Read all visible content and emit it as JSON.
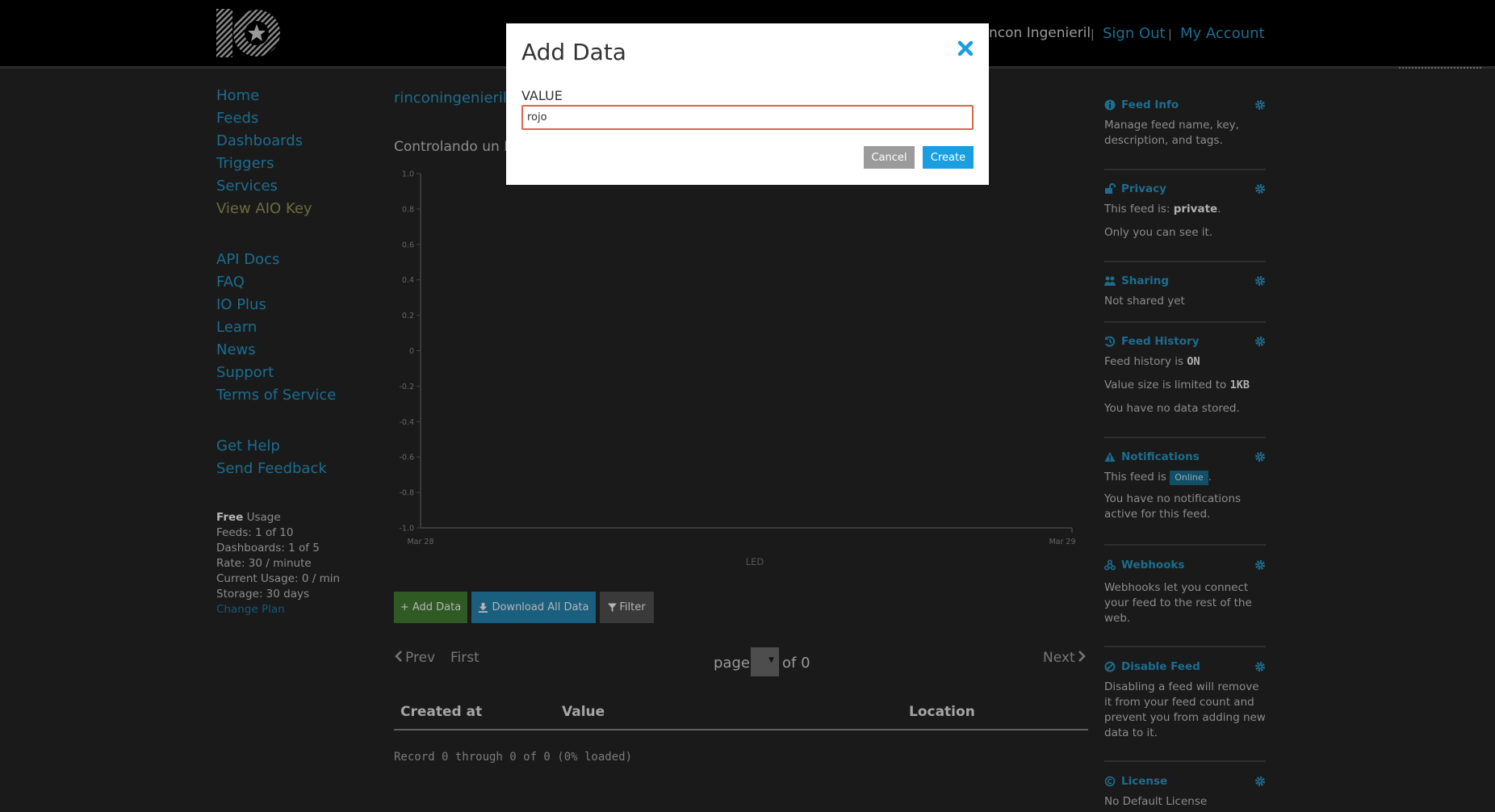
{
  "header": {
    "account_name": "ncon Ingenieril",
    "separator": "|",
    "sign_out": "Sign Out",
    "my_account": "My Account"
  },
  "left_nav": {
    "primary": [
      "Home",
      "Feeds",
      "Dashboards",
      "Triggers",
      "Services",
      "View AIO Key"
    ],
    "secondary": [
      "API Docs",
      "FAQ",
      "IO Plus",
      "Learn",
      "News",
      "Support",
      "Terms of Service"
    ],
    "help": [
      "Get Help",
      "Send Feedback"
    ],
    "usage": {
      "plan": "Free",
      "plan_suffix": " Usage",
      "feeds": "Feeds: 1 of 10",
      "dashboards": "Dashboards: 1 of 5",
      "rate": "Rate: 30 / minute",
      "current_usage": "Current Usage: 0 / min",
      "storage": "Storage: 30 days",
      "change_plan": "Change Plan"
    }
  },
  "main": {
    "breadcrumb": "rinconingenieril",
    "description": "Controlando un L",
    "buttons": {
      "add_data": "+ Add Data",
      "download_all": "Download All Data",
      "filter": "Filter"
    },
    "pagination": {
      "prev": "Prev",
      "first": "First",
      "page_label": "page",
      "of": "of 0",
      "next": "Next"
    },
    "table": {
      "columns": [
        "Created at",
        "Value",
        "Location"
      ],
      "status": "Record 0 through 0 of 0 (0% loaded)"
    }
  },
  "chart_data": {
    "type": "line",
    "title": "",
    "xlabel": "LED",
    "ylabel": "",
    "x_ticks": [
      "Mar 28",
      "Mar 29"
    ],
    "y_ticks": [
      "1.0",
      "0.8",
      "0.6",
      "0.4",
      "0.2",
      "0",
      "-0.2",
      "-0.4",
      "-0.6",
      "-0.8",
      "-1.0"
    ],
    "ylim": [
      -1.0,
      1.0
    ],
    "series": [],
    "grid": false
  },
  "sidebar": {
    "feed_info": {
      "title": "Feed Info",
      "text": "Manage feed name, key, description, and tags."
    },
    "privacy": {
      "title": "Privacy",
      "text_prefix": "This feed is: ",
      "status": "private",
      "text_suffix": ".",
      "text2": "Only you can see it."
    },
    "sharing": {
      "title": "Sharing",
      "text": "Not shared yet"
    },
    "feed_history": {
      "title": "Feed History",
      "line1_prefix": "Feed history is ",
      "line1_value": "ON",
      "line2_prefix": "Value size is limited to ",
      "line2_value": "1KB",
      "line3": "You have no data stored."
    },
    "notifications": {
      "title": "Notifications",
      "text_prefix": "This feed is ",
      "badge": "Online",
      "text_suffix": ".",
      "text2": "You have no notifications active for this feed."
    },
    "webhooks": {
      "title": "Webhooks",
      "text": "Webhooks let you connect your feed to the rest of the web."
    },
    "disable_feed": {
      "title": "Disable Feed",
      "text": "Disabling a feed will remove it from your feed count and prevent you from adding new data to it."
    },
    "license": {
      "title": "License",
      "text": "No Default License"
    }
  },
  "modal": {
    "title": "Add Data",
    "value_label": "VALUE",
    "value_input": "rojo",
    "cancel": "Cancel",
    "create": "Create"
  },
  "colors": {
    "link": "#1c6d8f",
    "page_bg": "#1a1a1a",
    "input_border": "#e0654a",
    "create_button": "#1a9ee0",
    "cancel_button": "#9b9b9b",
    "add_data_button": "#2f5a24",
    "download_button": "#1b5f7f"
  }
}
